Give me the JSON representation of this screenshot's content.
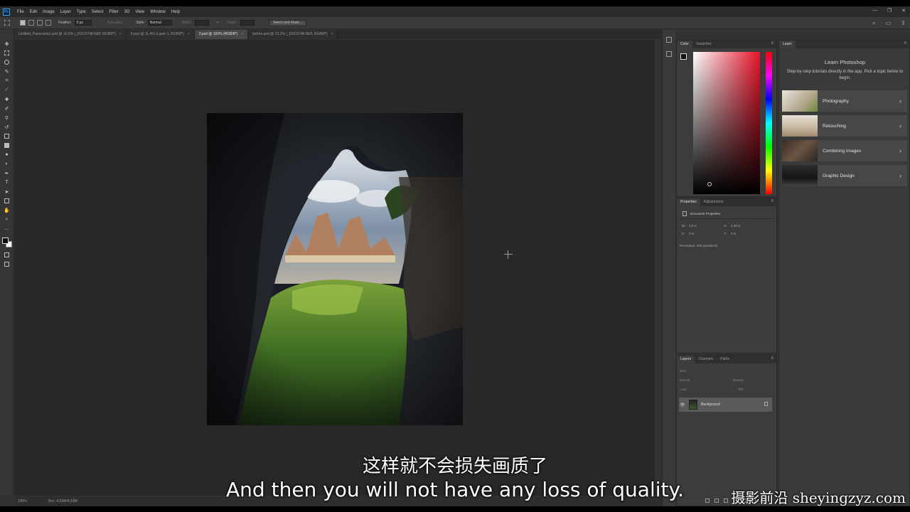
{
  "menubar": {
    "logo": "Ps",
    "items": [
      "File",
      "Edit",
      "Image",
      "Layer",
      "Type",
      "Select",
      "Filter",
      "3D",
      "View",
      "Window",
      "Help"
    ],
    "window_controls": [
      "—",
      "❐",
      "✕"
    ]
  },
  "options": {
    "feather_label": "Feather:",
    "feather_value": "0 px",
    "antialias_label": "Anti-alias",
    "style_label": "Style:",
    "style_value": "Normal",
    "width_label": "Width:",
    "height_label": "Height:",
    "select_mask_label": "Select and Mask..."
  },
  "tabs": [
    {
      "label": "Untitled_Panorama1.psd @ 16,6% (_DSC5748.NEF, RGB/8*)",
      "active": false
    },
    {
      "label": "5.psd @ 11,4% (Layer 1, RGB/8*)",
      "active": false
    },
    {
      "label": "3.psd @ 100% (RGB/8*)",
      "active": true
    },
    {
      "label": "before.psd @ 13,1% (_DSC5748.NEF, RGB/8*)",
      "active": false
    }
  ],
  "tab_close": "×",
  "status": {
    "zoom": "100%",
    "doc": "Doc: 4,53M/4,53M"
  },
  "color_panel": {
    "tabs": [
      "Color",
      "Swatches"
    ],
    "menu": "≡"
  },
  "properties_panel": {
    "tabs": [
      "Properties",
      "Adjustments"
    ],
    "menu": "≡",
    "heading": "Document Properties",
    "w_label": "W:",
    "w_value": "3,6 in",
    "h_label": "H:",
    "h_value": "4,39 in",
    "x_label": "X:",
    "x_value": "0 in",
    "y_label": "Y:",
    "y_value": "0 in",
    "resolution": "Resolution: 300 pixels/inch"
  },
  "layers_panel": {
    "tabs": [
      "Layers",
      "Channels",
      "Paths"
    ],
    "menu": "≡",
    "kind_label": "Kind",
    "blend_mode": "Normal",
    "opacity_label": "Opacity:",
    "lock_label": "Lock:",
    "fill_label": "Fill:",
    "layer_name": "Background",
    "eye": "👁"
  },
  "learn_panel": {
    "tab": "Learn",
    "menu": "≡",
    "title": "Learn Photoshop",
    "description": "Step-by-step tutorials directly in the app. Pick a topic below to begin.",
    "cards": [
      {
        "label": "Photography"
      },
      {
        "label": "Retouching"
      },
      {
        "label": "Combining Images"
      },
      {
        "label": "Graphic Design"
      }
    ],
    "chevron": "›"
  },
  "subtitles": {
    "chinese": "这样就不会损失画质了",
    "english": "And then you will not have any loss of quality."
  },
  "watermark": "摄影前沿 sheyingzyz.com"
}
